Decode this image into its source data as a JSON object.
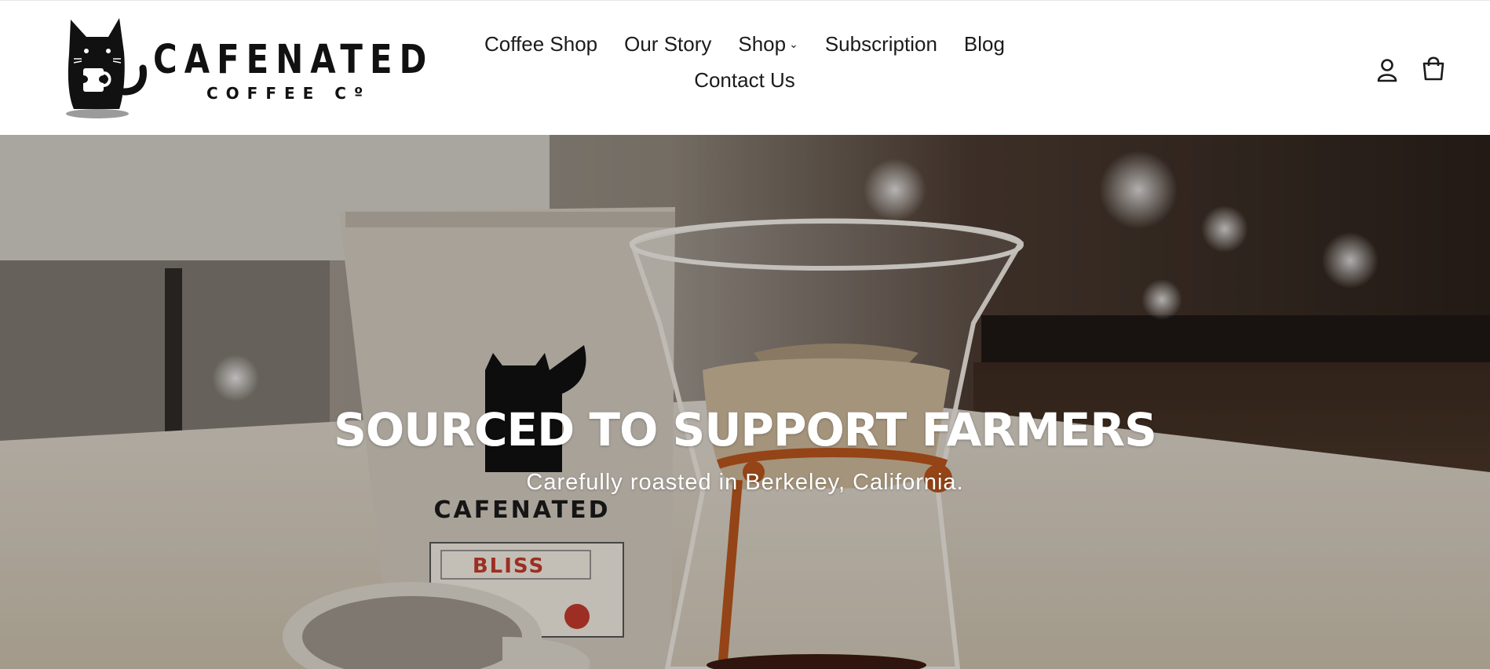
{
  "brand": {
    "name": "CAFENATED",
    "tagline": "COFFEE Cº"
  },
  "nav": {
    "items": [
      {
        "label": "Coffee Shop"
      },
      {
        "label": "Our Story"
      },
      {
        "label": "Shop",
        "dropdown": true
      },
      {
        "label": "Subscription"
      },
      {
        "label": "Blog"
      },
      {
        "label": "Contact Us"
      }
    ]
  },
  "header_icons": {
    "account": "account-icon",
    "cart": "cart-icon"
  },
  "hero": {
    "title": "SOURCED TO SUPPORT FARMERS",
    "subtitle": "Carefully roasted in Berkeley, California.",
    "bag_brand": "CAFENATED",
    "bag_label": "BLISS"
  },
  "colors": {
    "text": "#1b1b1b",
    "header_bg": "#ffffff",
    "hero_text": "#ffffff",
    "bag_label_red": "#c0392b",
    "leather_strap": "#b5531c"
  }
}
